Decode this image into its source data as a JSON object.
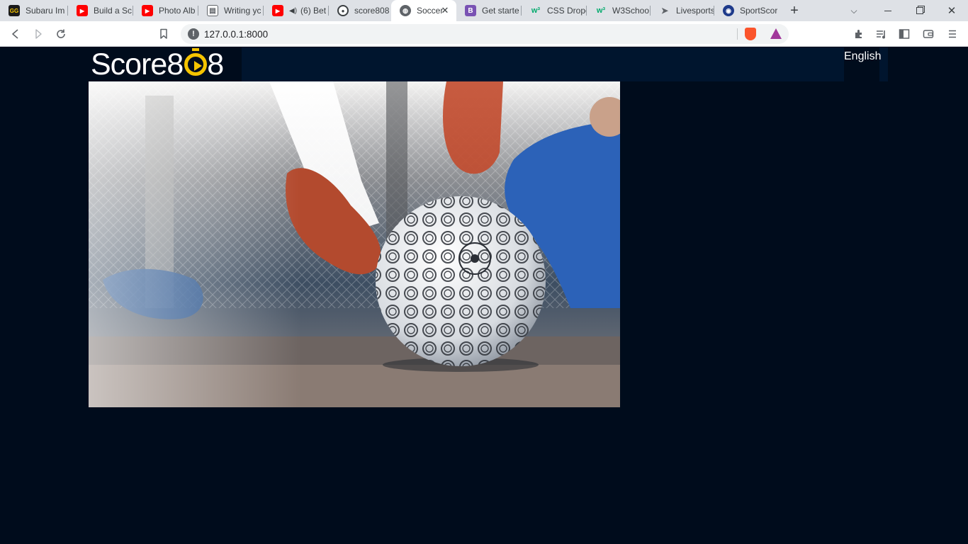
{
  "browser": {
    "tabs": [
      {
        "title": "Subaru Im",
        "favicon": "gg-icon",
        "favicon_color": "#1a1a1a",
        "favicon_text": "GG"
      },
      {
        "title": "Build a Sc",
        "favicon": "youtube-icon",
        "favicon_color": "#ff0000",
        "favicon_text": "▶"
      },
      {
        "title": "Photo Alb",
        "favicon": "youtube-icon",
        "favicon_color": "#ff0000",
        "favicon_text": "▶"
      },
      {
        "title": "Writing yc",
        "favicon": "document-icon",
        "favicon_color": "#5f6368",
        "favicon_text": "▤"
      },
      {
        "title": "(6) Bet",
        "favicon": "youtube-icon",
        "favicon_color": "#ff0000",
        "favicon_text": "▶"
      },
      {
        "title": "score808",
        "favicon": "soccer-ball-icon",
        "favicon_color": "#3c4043",
        "favicon_text": "⚽"
      },
      {
        "title": "Soccer",
        "favicon": "globe-icon",
        "favicon_color": "#5f6368",
        "favicon_text": "◍",
        "active": true
      },
      {
        "title": "Get starte",
        "favicon": "bootstrap-icon",
        "favicon_color": "#7952b3",
        "favicon_text": "B"
      },
      {
        "title": "CSS Dropc",
        "favicon": "w3schools-icon",
        "favicon_color": "#04aa6d",
        "favicon_text": "w³"
      },
      {
        "title": "W3Schoo",
        "favicon": "w3schools-icon",
        "favicon_color": "#04aa6d",
        "favicon_text": "w³"
      },
      {
        "title": "Livesports",
        "favicon": "arrow-icon",
        "favicon_color": "#5f6368",
        "favicon_text": "➤"
      },
      {
        "title": "SportScor",
        "favicon": "sportscore-icon",
        "favicon_color": "#1e3a8a",
        "favicon_text": "◉"
      }
    ],
    "new_tab_label": "+",
    "url": "127.0.0.1:8000"
  },
  "site": {
    "logo_text_1": "Score8",
    "logo_text_2": "8",
    "language": "English"
  },
  "colors": {
    "page_background": "#000c1c",
    "header_background": "#00152e",
    "logo_accent": "#f5c400"
  }
}
